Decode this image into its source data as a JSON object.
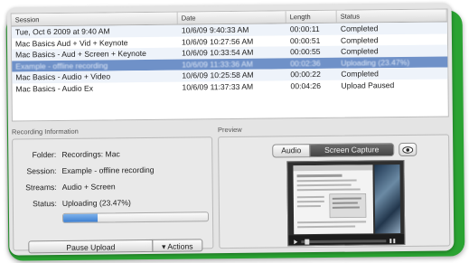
{
  "table": {
    "headers": [
      "Session",
      "Date",
      "Length",
      "Status"
    ],
    "rows": [
      {
        "session": "Tue, Oct 6 2009 at 9:40 AM",
        "date": "10/6/09 9:40:33 AM",
        "length": "00:00:11",
        "status": "Completed"
      },
      {
        "session": "Mac Basics Aud + Vid + Keynote",
        "date": "10/6/09 10:27:56 AM",
        "length": "00:00:51",
        "status": "Completed"
      },
      {
        "session": "Mac Basics - Aud + Screen + Keynote",
        "date": "10/6/09 10:33:54 AM",
        "length": "00:00:55",
        "status": "Completed"
      },
      {
        "session": "Example - offline recording",
        "date": "10/6/09 11:33:36 AM",
        "length": "00:02:36",
        "status": "Uploading (23.47%)"
      },
      {
        "session": "Mac Basics - Audio + Video",
        "date": "10/6/09 10:25:58 AM",
        "length": "00:00:22",
        "status": "Completed"
      },
      {
        "session": "Mac Basics - Audio Ex",
        "date": "10/6/09 11:37:33 AM",
        "length": "00:04:26",
        "status": "Upload Paused"
      }
    ]
  },
  "info": {
    "title": "Recording Information",
    "folder_label": "Folder:",
    "folder_value": "Recordings: Mac",
    "session_label": "Session:",
    "session_value": "Example - offline recording",
    "streams_label": "Streams:",
    "streams_value": "Audio + Screen",
    "status_label": "Status:",
    "status_value": "Uploading (23.47%)",
    "progress": 0.2347,
    "pause_button": "Pause Upload",
    "actions_button": "▾ Actions"
  },
  "preview": {
    "title": "Preview",
    "tab_audio": "Audio",
    "tab_screen": "Screen Capture",
    "eye_icon": "eye-icon"
  },
  "colors": {
    "frame": "#2aa332",
    "selection": "#6f91c8",
    "progress": "#4a8ad8"
  }
}
